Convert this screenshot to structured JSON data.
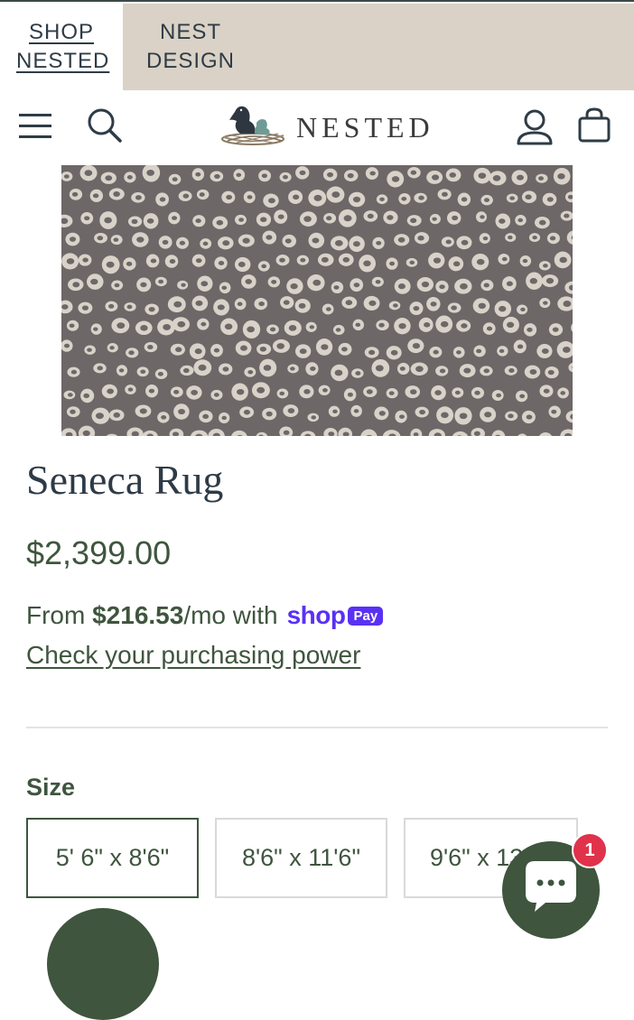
{
  "top_tabs": {
    "shop_nested": "SHOP NESTED",
    "nest_design": "NEST DESIGN"
  },
  "header": {
    "brand": "NESTED",
    "icons": [
      "menu-icon",
      "search-icon",
      "account-icon",
      "cart-icon"
    ]
  },
  "product": {
    "image_alt": "Seneca rug product image",
    "title": "Seneca Rug",
    "price": "$2,399.00",
    "installment_prefix": "From ",
    "installment_amount": "$216.53",
    "installment_suffix": "/mo with",
    "shop_word": "shop",
    "pay_badge": "Pay",
    "purchasing_power_link": "Check your purchasing power"
  },
  "size": {
    "label": "Size",
    "options": [
      "5' 6\" x 8'6\"",
      "8'6\" x 11'6\"",
      "9'6\" x 13"
    ],
    "selected_index": 0
  },
  "chat": {
    "unread_count": "1"
  },
  "colors": {
    "accent_green": "#3f553e",
    "tab_beige": "#dad2c6",
    "shop_pay_purple": "#5a31f4",
    "badge_red": "#e0324b",
    "rug_base": "#6d6768",
    "rug_spot": "#d9d2c9"
  }
}
